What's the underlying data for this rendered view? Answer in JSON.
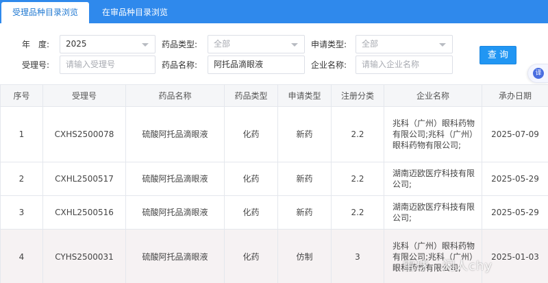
{
  "tabs": [
    {
      "label": "受理品种目录浏览"
    },
    {
      "label": "在审品种目录浏览"
    }
  ],
  "filters": {
    "year_label": "年　度:",
    "year_value": "2025",
    "drug_type_label": "药品类型:",
    "drug_type_value": "全部",
    "apply_type_label": "申请类型:",
    "apply_type_value": "全部",
    "accept_no_label": "受理号:",
    "accept_no_placeholder": "请输入受理号",
    "drug_name_label": "药品名称:",
    "drug_name_value": "阿托品滴眼液",
    "company_label": "企业名称:",
    "company_placeholder": "请输入企业名称",
    "query_button": "查 询"
  },
  "float_tab": {
    "glyph": "译"
  },
  "table": {
    "columns": [
      "序号",
      "受理号",
      "药品名称",
      "药品类型",
      "申请类型",
      "注册分类",
      "企业名称",
      "承办日期"
    ],
    "rows": [
      {
        "no": "1",
        "accept_no": "CXHS2500078",
        "drug_name": "硫酸阿托品滴眼液",
        "drug_type": "化药",
        "apply_type": "新药",
        "category": "2.2",
        "company": "兆科（广州）眼科药物有限公司;兆科（广州）眼科药物有限公司;",
        "date": "2025-07-09"
      },
      {
        "no": "2",
        "accept_no": "CXHL2500517",
        "drug_name": "硫酸阿托品滴眼液",
        "drug_type": "化药",
        "apply_type": "新药",
        "category": "2.2",
        "company": "湖南迈欧医疗科技有限公司;",
        "date": "2025-05-29"
      },
      {
        "no": "3",
        "accept_no": "CXHL2500516",
        "drug_name": "硫酸阿托品滴眼液",
        "drug_type": "化药",
        "apply_type": "新药",
        "category": "2.2",
        "company": "湖南迈欧医疗科技有限公司;",
        "date": "2025-05-29"
      },
      {
        "no": "4",
        "accept_no": "CYHS2500031",
        "drug_name": "硫酸阿托品滴眼液",
        "drug_type": "化药",
        "apply_type": "仿制",
        "category": "3",
        "company": "兆科（广州）眼科药物有限公司;兆科（广州）眼科药物有限公司;",
        "date": "2025-01-03"
      }
    ]
  },
  "watermark": "雪球 · 闲人chy"
}
